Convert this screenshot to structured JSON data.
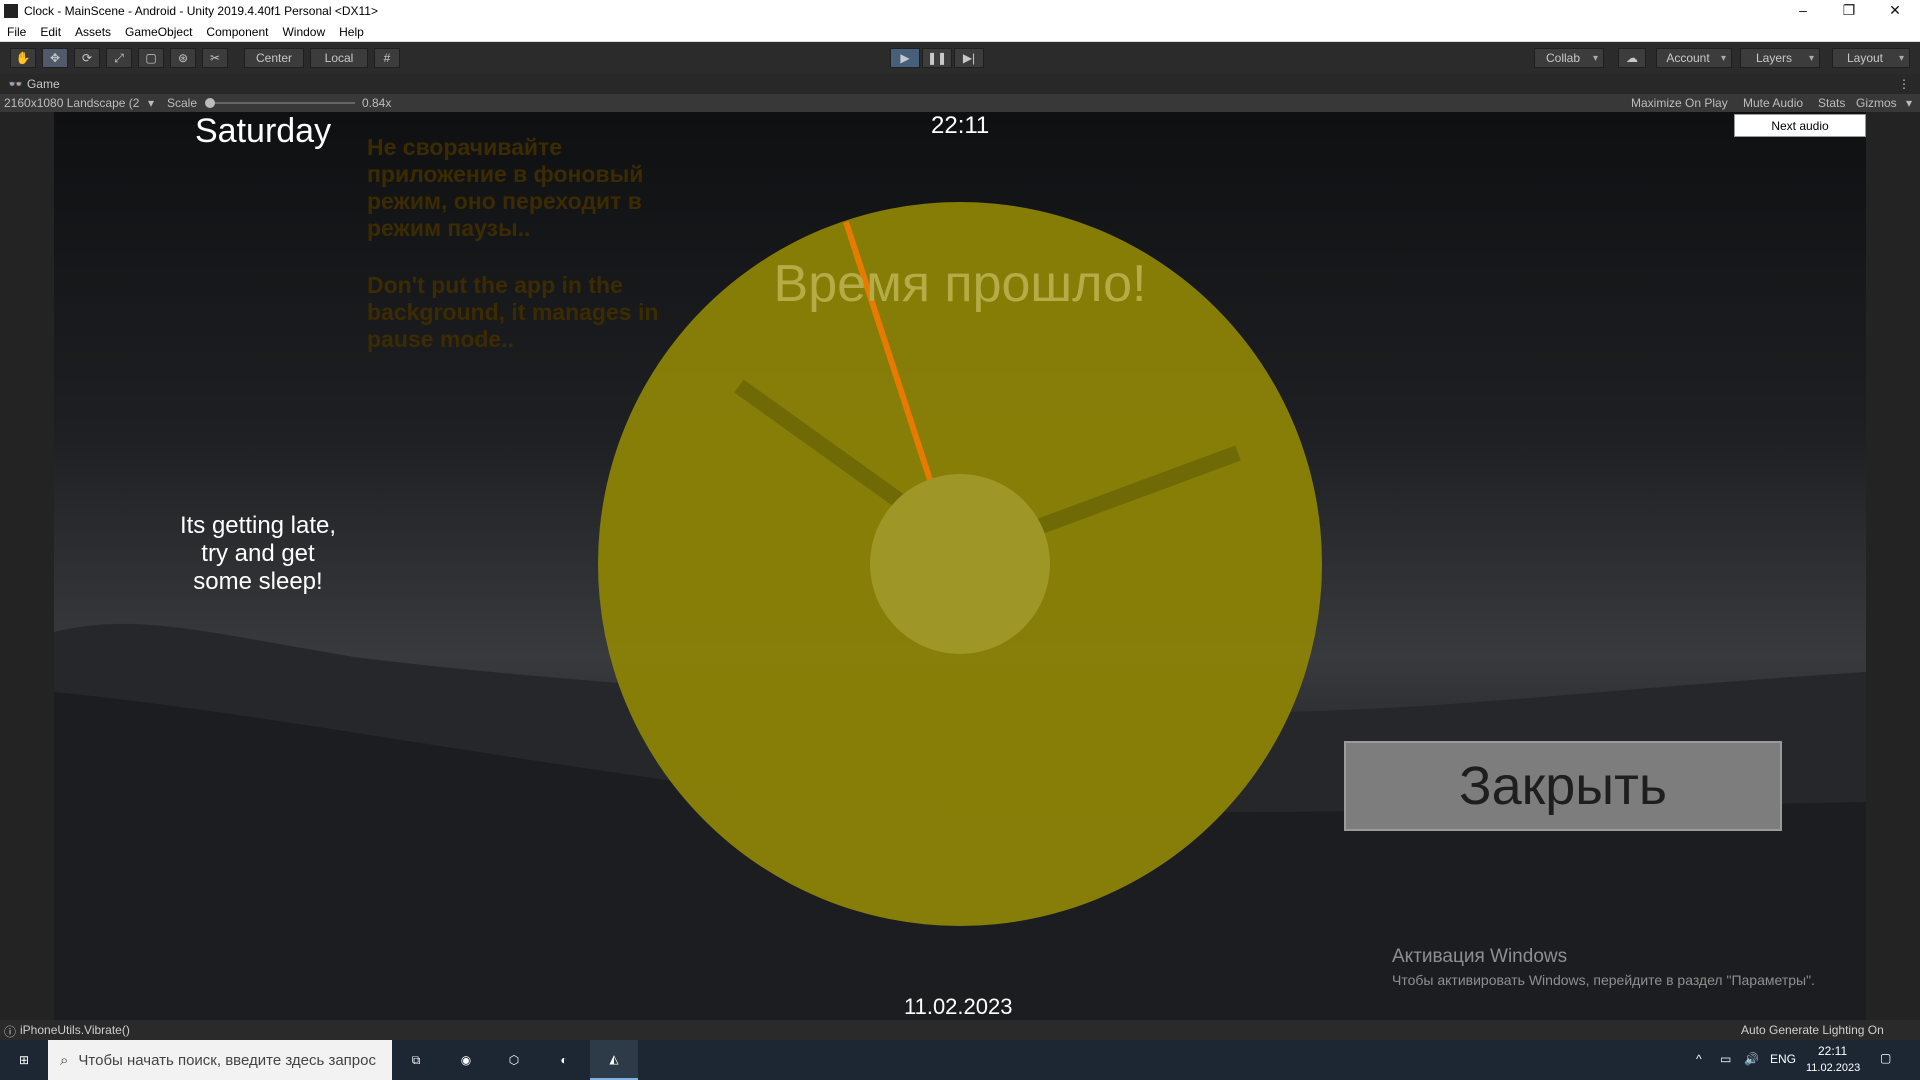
{
  "window": {
    "title": "Clock - MainScene - Android - Unity 2019.4.40f1 Personal <DX11>",
    "controls": [
      "minimize-icon",
      "restore-icon",
      "close-icon"
    ]
  },
  "menu": [
    "File",
    "Edit",
    "Assets",
    "GameObject",
    "Component",
    "Window",
    "Help"
  ],
  "toolbar": {
    "tools": [
      "hand-icon",
      "move-icon",
      "rotate-icon",
      "scale-icon",
      "rect-icon",
      "transform-icon",
      "custom-tool-icon"
    ],
    "pivot": "Center",
    "space": "Local",
    "play": [
      "play-icon",
      "pause-icon",
      "step-icon"
    ],
    "collab": "Collab",
    "account": "Account",
    "layers": "Layers",
    "layout": "Layout"
  },
  "game_tab": {
    "label": "Game",
    "resolution": "2160x1080 Landscape (2",
    "scale_label": "Scale",
    "scale_value": "0.84x",
    "maximize": "Maximize On Play",
    "mute": "Mute Audio",
    "stats": "Stats",
    "gizmos": "Gizmos"
  },
  "game": {
    "day": "Saturday",
    "time": "22:11",
    "next_audio": "Next audio",
    "warning_ru": "Не сворачивайте приложение в фоновый режим, оно переходит в режим паузы..",
    "warning_en": "Don't put the app in the background, it manages in pause mode..",
    "time_up": "Время прошло!",
    "sleep_message": [
      "Its getting late,",
      "try and get",
      "some sleep!"
    ],
    "close_button": "Закрыть",
    "date": "11.02.2023",
    "activation_title": "Активация Windows",
    "activation_text": "Чтобы активировать Windows, перейдите в раздел \"Параметры\".",
    "colors": {
      "dial": "#8a8107",
      "dial_center": "#9e9626",
      "hands": "#6f6a05",
      "second_hand": "#e87a00",
      "warning_text": "#3d2b00",
      "close_button_bg": "#7d7d7d"
    }
  },
  "status": {
    "message": "iPhoneUtils.Vibrate()",
    "right": "Auto Generate Lighting On"
  },
  "taskbar": {
    "search_placeholder": "Чтобы начать поиск, введите здесь запрос",
    "lang": "ENG",
    "clock_time": "22:11",
    "clock_date": "11.02.2023"
  }
}
